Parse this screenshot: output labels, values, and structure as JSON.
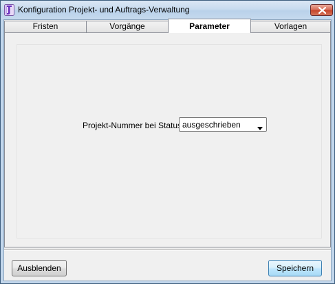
{
  "window": {
    "title": "Konfiguration Projekt- und Auftrags-Verwaltung",
    "app_icon": "app-icon",
    "close_icon": "close-icon"
  },
  "tabs": [
    {
      "label": "Fristen",
      "active": false
    },
    {
      "label": "Vorgänge",
      "active": false
    },
    {
      "label": "Parameter",
      "active": true
    },
    {
      "label": "Vorlagen",
      "active": false
    }
  ],
  "parameter": {
    "status_label": "Projekt-Nummer bei Status :",
    "status_value": "ausgeschrieben"
  },
  "footer": {
    "hide_label": "Ausblenden",
    "save_label": "Speichern"
  },
  "colors": {
    "close_button": "#c6462c",
    "title_bar": "#c8dbef",
    "client_background": "#f0f0f0"
  }
}
